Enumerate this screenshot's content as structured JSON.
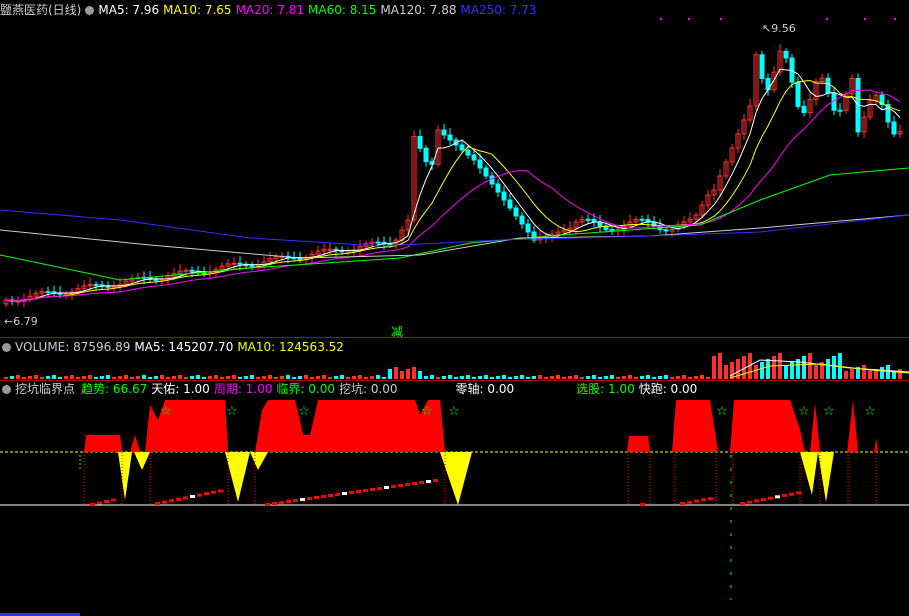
{
  "main": {
    "title": "鹽燕医药(日线)",
    "indicators": [
      {
        "text": "MA5: 7.96",
        "color": "#ffffff"
      },
      {
        "text": "MA10: 7.65",
        "color": "#ffff00"
      },
      {
        "text": "MA20: 7.81",
        "color": "#ff00ff"
      },
      {
        "text": "MA60: 8.15",
        "color": "#00ff00"
      },
      {
        "text": "MA120: 7.88",
        "color": "#cccccc"
      },
      {
        "text": "MA250: 7.73",
        "color": "#3030ff"
      }
    ],
    "high_label": "9.56",
    "low_label": "6.79",
    "marker": "减"
  },
  "volume": {
    "title": "VOLUME: 87596.89",
    "indicators": [
      {
        "text": "MA5: 145207.70",
        "color": "#ffffff"
      },
      {
        "text": "MA10: 124563.52",
        "color": "#ffff00"
      }
    ]
  },
  "indicator": {
    "title": "挖坑临界点",
    "indicators": [
      {
        "text": "趋势: 66.67",
        "color": "#00ff00"
      },
      {
        "text": "天佑: 1.00",
        "color": "#ffffff"
      },
      {
        "text": "周期: 1.00",
        "color": "#ff00ff"
      },
      {
        "text": "临界: 0.00",
        "color": "#00ff00"
      },
      {
        "text": "挖坑: 0.00",
        "color": "#cccccc"
      },
      {
        "text": "零轴: 0.00",
        "color": "#ffffff"
      },
      {
        "text": "选股: 1.00",
        "color": "#00ff00"
      },
      {
        "text": "快跑: 0.00",
        "color": "#ffffff"
      }
    ],
    "star": "☆"
  },
  "colors": {
    "up": "#ff3030",
    "down": "#00ffff",
    "ma5": "#ffffff",
    "ma10": "#ffff00",
    "ma20": "#ff00ff",
    "ma60": "#00ff00",
    "ma120": "#cccccc",
    "ma250": "#3030ff",
    "fill_red": "#ff0000",
    "fill_yellow": "#ffff00"
  }
}
